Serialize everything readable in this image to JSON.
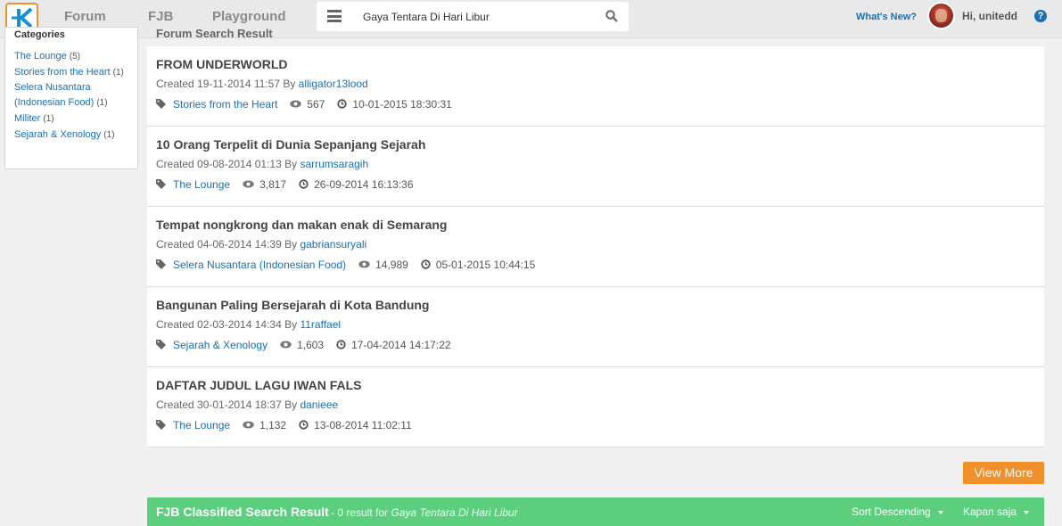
{
  "nav": {
    "links": [
      "Forum",
      "FJB",
      "Playground"
    ],
    "search_value": "Gaya Tentara Di Hari Libur",
    "whats_new": "What's New?",
    "greeting": "Hi, unitedd",
    "help": "?"
  },
  "sidebar": {
    "title": "Categories",
    "items": [
      {
        "label": "The Lounge",
        "count": "(5)"
      },
      {
        "label": "Stories from the Heart",
        "count": "(1)"
      },
      {
        "label": "Selera Nusantara (Indonesian Food)",
        "count": "(1)"
      },
      {
        "label": "Militer",
        "count": "(1)"
      },
      {
        "label": "Sejarah & Xenology",
        "count": "(1)"
      }
    ]
  },
  "main": {
    "partial_heading": "Forum Search Result",
    "threads": [
      {
        "title": "FROM UNDERWORLD",
        "created": "Created 19-11-2014 11:57 By",
        "author": "alligator13lood",
        "category": "Stories from the Heart",
        "views": "567",
        "last": "10-01-2015 18:30:31"
      },
      {
        "title": "10 Orang Terpelit di Dunia Sepanjang Sejarah",
        "created": "Created 09-08-2014 01:13 By",
        "author": "sarrumsaragih",
        "category": "The Lounge",
        "views": "3,817",
        "last": "26-09-2014 16:13:36"
      },
      {
        "title": "Tempat nongkrong dan makan enak di Semarang",
        "created": "Created 04-06-2014 14:39 By",
        "author": "gabriansuryali",
        "category": "Selera Nusantara (Indonesian Food)",
        "views": "14,989",
        "last": "05-01-2015 10:44:15"
      },
      {
        "title": "Bangunan Paling Bersejarah di Kota Bandung",
        "created": "Created 02-03-2014 14:34 By",
        "author": "11raffael",
        "category": "Sejarah & Xenology",
        "views": "1,603",
        "last": "17-04-2014 14:17:22"
      },
      {
        "title": "DAFTAR JUDUL LAGU IWAN FALS",
        "created": "Created 30-01-2014 18:37 By",
        "author": "danieee",
        "category": "The Lounge",
        "views": "1,132",
        "last": "13-08-2014 11:02:11"
      }
    ],
    "view_more": "View More"
  },
  "fjb": {
    "title": "FJB Classified Search Result",
    "result_prefix": "- 0 result for",
    "query": "Gaya Tentara Di Hari Libur",
    "sort": "Sort Descending",
    "time": "Kapan saja"
  },
  "colors": {
    "accent": "#f0902a",
    "link": "#1a6fb5",
    "fjb_green": "#5ccf7e"
  },
  "icons": [
    "kaskus-logo-icon",
    "hamburger-menu-icon",
    "search-icon",
    "avatar",
    "help-icon",
    "tag-icon",
    "eye-icon",
    "clock-icon",
    "caret-down-icon"
  ]
}
